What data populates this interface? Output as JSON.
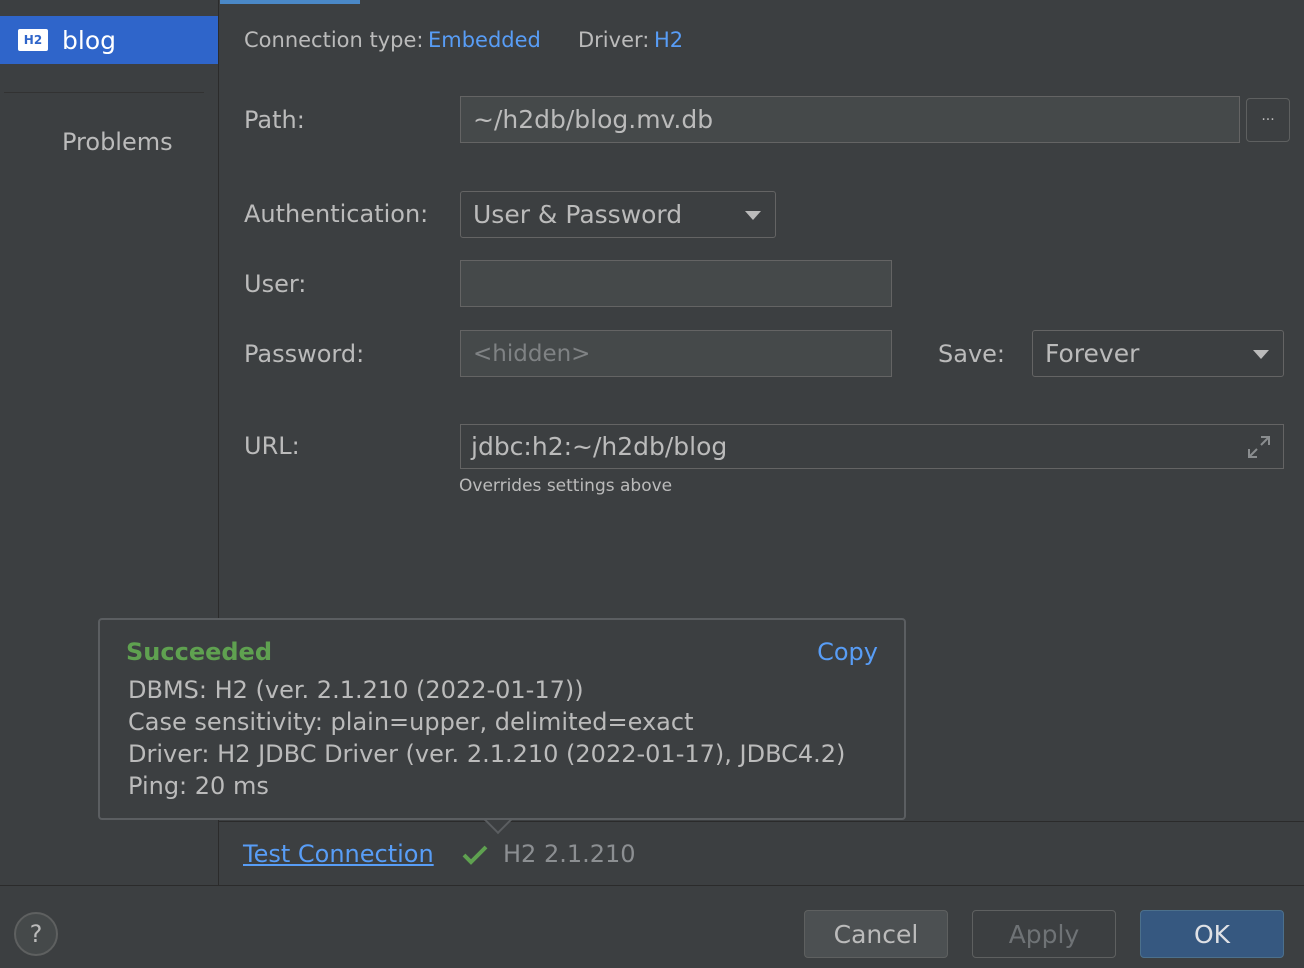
{
  "sidebar": {
    "selected_badge": "H2",
    "selected_label": "blog",
    "problems_label": "Problems"
  },
  "header": {
    "connection_type_label": "Connection type:",
    "connection_type_value": "Embedded",
    "driver_label": "Driver:",
    "driver_value": "H2"
  },
  "form": {
    "path_label": "Path:",
    "path_value": "~/h2db/blog.mv.db",
    "browse_label": "···",
    "auth_label": "Authentication:",
    "auth_value": "User & Password",
    "user_label": "User:",
    "user_value": "",
    "password_label": "Password:",
    "password_placeholder": "<hidden>",
    "save_label": "Save:",
    "save_value": "Forever",
    "url_label": "URL:",
    "url_value": "jdbc:h2:~/h2db/blog",
    "url_hint": "Overrides settings above"
  },
  "popup": {
    "status": "Succeeded",
    "copy_label": "Copy",
    "lines": [
      "DBMS: H2 (ver. 2.1.210 (2022-01-17))",
      "Case sensitivity: plain=upper, delimited=exact",
      "Driver: H2 JDBC Driver (ver. 2.1.210 (2022-01-17), JDBC4.2)",
      "Ping: 20 ms"
    ]
  },
  "test": {
    "link_label": "Test Connection",
    "version": "H2 2.1.210"
  },
  "footer": {
    "help_label": "?",
    "cancel_label": "Cancel",
    "apply_label": "Apply",
    "ok_label": "OK"
  },
  "colors": {
    "accent": "#2f65ca",
    "link": "#589df6",
    "success": "#5fa150",
    "background": "#3c3f41"
  }
}
